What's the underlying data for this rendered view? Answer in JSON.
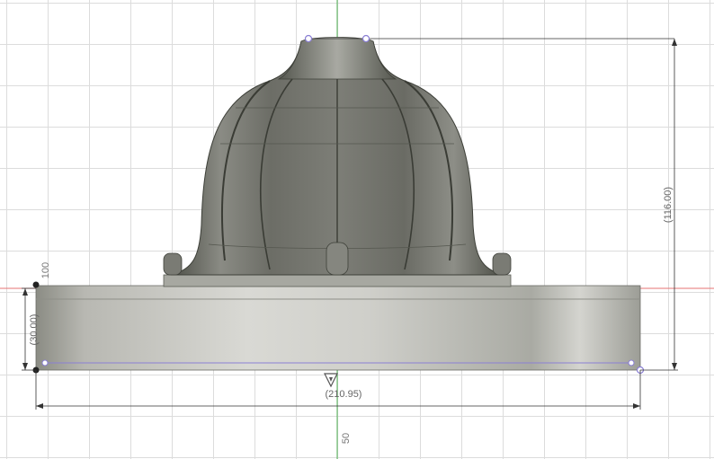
{
  "dimensions": {
    "height_total": "(116.00)",
    "base_height": "(30.00)",
    "width": "(210.95)",
    "axis_label_100": "100",
    "axis_label_50": "50"
  },
  "colors": {
    "grid": "#dcdcdc",
    "axis_green": "#4caf50",
    "axis_red": "#e57373",
    "sketch_purple": "#8a7fd4",
    "dimension_line": "#333333",
    "body_dark": "#5f6158",
    "body_light": "#c9c9c4"
  },
  "icons": {
    "view_marker": "inverted-triangle-icon",
    "origin": "origin-point-icon"
  }
}
